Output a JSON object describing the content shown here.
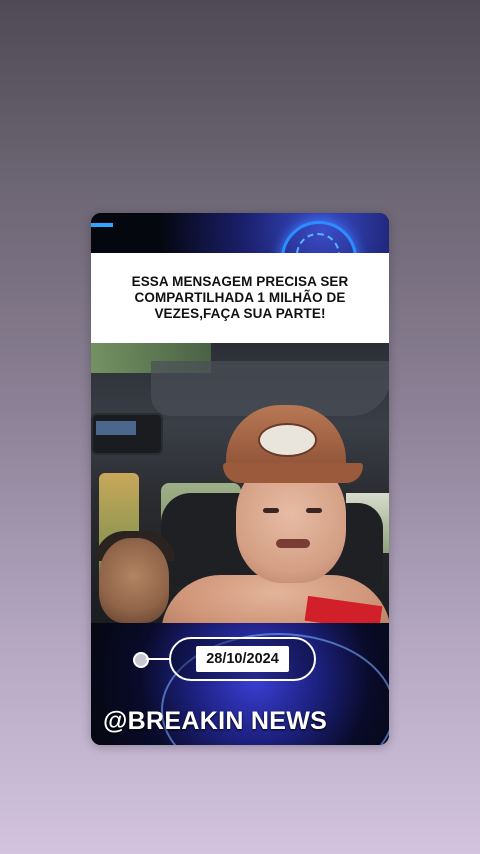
{
  "post": {
    "headline": "ESSA MENSAGEM PRECISA SER COMPARTILHADA 1 MILHÃO DE VEZES,FAÇA SUA PARTE!",
    "date": "28/10/2024",
    "handle": "@BREAKIN NEWS"
  },
  "colors": {
    "accent_blue": "#2ea3ff",
    "card_background": "#05070f",
    "red_cloth": "#d1202a"
  }
}
